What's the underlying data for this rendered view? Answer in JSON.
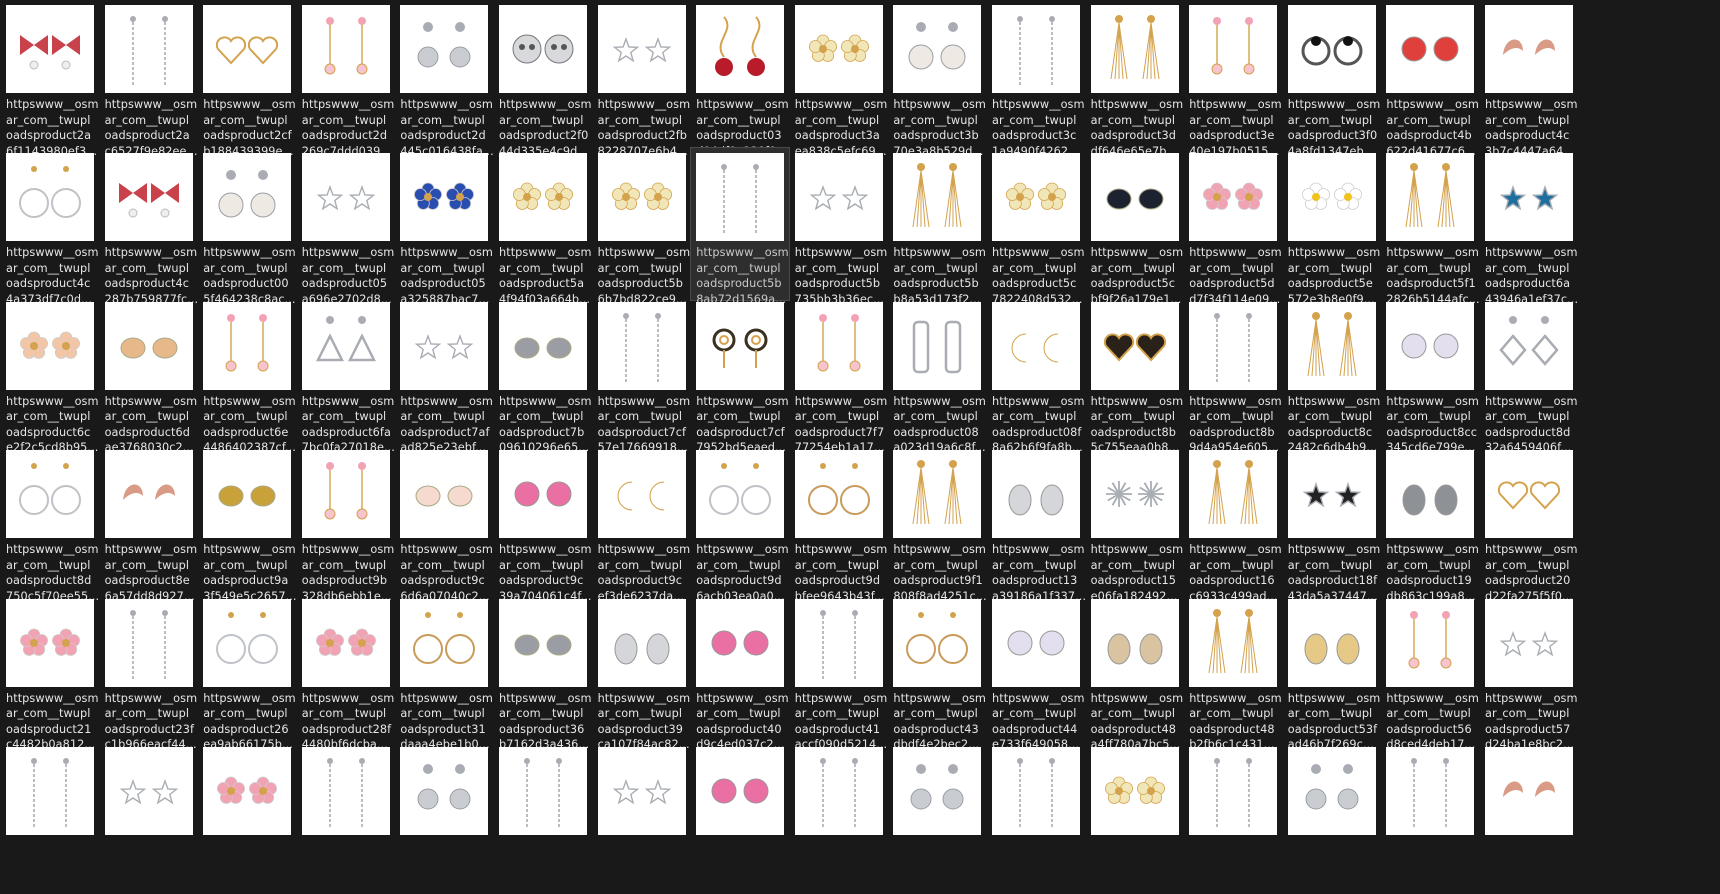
{
  "window": {
    "background": "#191919",
    "selected_tile": [
      1,
      7
    ]
  },
  "files": [
    [
      "httpswww__osm|ar_com__twupl|oadsproduct2a|6f1143980ef3...|bow",
      "httpswww__osm|ar_com__twupl|oadsproduct2a|c6527f9e82ee...|chain",
      "httpswww__osm|ar_com__twupl|oadsproduct2cf|b188439399e...|heart",
      "httpswww__osm|ar_com__twupl|oadsproduct2d|269c7ddd039...|flower-drop",
      "httpswww__osm|ar_com__twupl|oadsproduct2d|445c016438fa...|ball",
      "httpswww__osm|ar_com__twupl|oadsproduct2f0|44d335e4c9d...|skull",
      "httpswww__osm|ar_com__twupl|oadsproduct2fb|8228707e6b4...|star-drop",
      "httpswww__osm|ar_com__twupl|oadsproduct03|d94df0a130f0...|rose",
      "httpswww__osm|ar_com__twupl|oadsproduct3a|ea838c5efc69...|flower",
      "httpswww__osm|ar_com__twupl|oadsproduct3b|70e3a8b529d...|pearl",
      "httpswww__osm|ar_com__twupl|oadsproduct3c|1a9490f4262...|chain",
      "httpswww__osm|ar_com__twupl|oadsproduct3d|df646e65e7b...|fringe",
      "httpswww__osm|ar_com__twupl|oadsproduct3e|40e197b0515...|flower-drop",
      "httpswww__osm|ar_com__twupl|oadsproduct3f0|4a8fd1347eb...|ring",
      "httpswww__osm|ar_com__twupl|oadsproduct4b|622d41677c6...|stud-red",
      "httpswww__osm|ar_com__twupl|oadsproduct4c|3b7c4447a64...|dolphin"
    ],
    [
      "httpswww__osm|ar_com__twupl|oadsproduct4c|4a373df7c0d...|hoop",
      "httpswww__osm|ar_com__twupl|oadsproduct4c|287b759877fc...|bow",
      "httpswww__osm|ar_com__twupl|oadsproduct00|5f464238c8ac...|pearl",
      "httpswww__osm|ar_com__twupl|oadsproduct05|a696e2702d8...|star",
      "httpswww__osm|ar_com__twupl|oadsproduct05|a325887bac7...|flower-blue",
      "httpswww__osm|ar_com__twupl|oadsproduct5a|4f94f03a664b...|flower",
      "httpswww__osm|ar_com__twupl|oadsproduct5b|6b7bd822ce9...|flower",
      "httpswww__osm|ar_com__twupl|oadsproduct5b|8ab72d1569a...|chain",
      "httpswww__osm|ar_com__twupl|oadsproduct5b|735bb3b36ec...|star",
      "httpswww__osm|ar_com__twupl|oadsproduct5b|b8a53d173f2...|fringe",
      "httpswww__osm|ar_com__twupl|oadsproduct5c|7822408d532...|flower",
      "httpswww__osm|ar_com__twupl|oadsproduct5c|bf9f26a179e1...|dog",
      "httpswww__osm|ar_com__twupl|oadsproduct5d|d7f34f114e09...|flower-pink",
      "httpswww__osm|ar_com__twupl|oadsproduct5e|572e3b8e0f9...|daisy",
      "httpswww__osm|ar_com__twupl|oadsproduct5f1|2826b5144afc...|fringe",
      "httpswww__osm|ar_com__twupl|oadsproduct6a|43946a1ef37c...|star-blue"
    ],
    [
      "httpswww__osm|ar_com__twupl|oadsproduct6c|e2f2c5cd8b95...|rose-stud",
      "httpswww__osm|ar_com__twupl|oadsproduct6d|ae3768030c2...|guitar",
      "httpswww__osm|ar_com__twupl|oadsproduct6e|4486402387cf...|flower-drop",
      "httpswww__osm|ar_com__twupl|oadsproduct6fa|7bc0fa27018e...|triangle",
      "httpswww__osm|ar_com__twupl|oadsproduct7af|ad825e23ebf...|star",
      "httpswww__osm|ar_com__twupl|oadsproduct7b|09610296e65...|fish",
      "httpswww__osm|ar_com__twupl|oadsproduct7cf|57e17669918...|chain",
      "httpswww__osm|ar_com__twupl|oadsproduct7cf|7952bd5eaed...|spiral",
      "httpswww__osm|ar_com__twupl|oadsproduct7f7|77254eb1a17...|flower-drop",
      "httpswww__osm|ar_com__twupl|oadsproduct08|a023d19a6c8f...|rect",
      "httpswww__osm|ar_com__twupl|oadsproduct08f|8a62b6f9fa8b...|moon",
      "httpswww__osm|ar_com__twupl|oadsproduct8b|5c755eaa0b8...|heart-dark",
      "httpswww__osm|ar_com__twupl|oadsproduct8b|9d4a954e605...|chain",
      "httpswww__osm|ar_com__twupl|oadsproduct8c|2482c6db4b9...|fringe",
      "httpswww__osm|ar_com__twupl|oadsproduct8cc|345cd6e799e...|stud-white",
      "httpswww__osm|ar_com__twupl|oadsproduct8d|32a6459406f...|diamond"
    ],
    [
      "httpswww__osm|ar_com__twupl|oadsproduct8d|750c5f70ee55...|hoop",
      "httpswww__osm|ar_com__twupl|oadsproduct8e|6a57dd8d927...|dolphin",
      "httpswww__osm|ar_com__twupl|oadsproduct9a|3f549e5c2657...|cat",
      "httpswww__osm|ar_com__twupl|oadsproduct9b|328db6ebb1e...|flower-drop",
      "httpswww__osm|ar_com__twupl|oadsproduct9c|6d6a07040c2...|clover",
      "httpswww__osm|ar_com__twupl|oadsproduct9c|39a704061c4f...|stud-pink",
      "httpswww__osm|ar_com__twupl|oadsproduct9c|ef3de6237da...|moon",
      "httpswww__osm|ar_com__twupl|oadsproduct9d|6acb03ea0a0...|hoop",
      "httpswww__osm|ar_com__twupl|oadsproduct9d|bfee9643b43f...|wreath",
      "httpswww__osm|ar_com__twupl|oadsproduct9f1|808f8ad4251c...|fringe",
      "httpswww__osm|ar_com__twupl|oadsproduct13|a39186a1f337...|cuff",
      "httpswww__osm|ar_com__twupl|oadsproduct15|e06fa182492...|snowflake",
      "httpswww__osm|ar_com__twupl|oadsproduct16|c6933c499ad...|fringe",
      "httpswww__osm|ar_com__twupl|oadsproduct18f|43da5a37447...|star-dark",
      "httpswww__osm|ar_com__twupl|oadsproduct19|db863c199a8...|drop",
      "httpswww__osm|ar_com__twupl|oadsproduct20|d22fa275f5f0...|heart"
    ],
    [
      "httpswww__osm|ar_com__twupl|oadsproduct21|c4482b0a812...|flower-pink",
      "httpswww__osm|ar_com__twupl|oadsproduct23f|c1b966eacf44...|chain",
      "httpswww__osm|ar_com__twupl|oadsproduct26|ea9ab66175b...|hoop",
      "httpswww__osm|ar_com__twupl|oadsproduct28f|4480bf6dcba...|flower-pink",
      "httpswww__osm|ar_com__twupl|oadsproduct31|daaa4ebe1b0...|wreath",
      "httpswww__osm|ar_com__twupl|oadsproduct36|b7162d3a436...|fish",
      "httpswww__osm|ar_com__twupl|oadsproduct39|ca107f84ac82...|cuff",
      "httpswww__osm|ar_com__twupl|oadsproduct40|d9c4ed037c2...|stud-pink",
      "httpswww__osm|ar_com__twupl|oadsproduct41|accf090d5214...|chain",
      "httpswww__osm|ar_com__twupl|oadsproduct43|dbdf4e2bec2...|wreath",
      "httpswww__osm|ar_com__twupl|oadsproduct44|e733f649058...|stud-white",
      "httpswww__osm|ar_com__twupl|oadsproduct48|a4ff780a7bc5...|stone",
      "httpswww__osm|ar_com__twupl|oadsproduct48|b2fb6c1c431...|fringe",
      "httpswww__osm|ar_com__twupl|oadsproduct53f|ad46b7f269c...|disc",
      "httpswww__osm|ar_com__twupl|oadsproduct56|d8ced4deb17...|flower-drop",
      "httpswww__osm|ar_com__twupl|oadsproduct57|d24ba1e8bc2...|star"
    ],
    [
      "||||chain",
      "||||star",
      "||||flower-pink",
      "||||chain",
      "||||ball",
      "||||chain",
      "||||star",
      "||||stud-pink",
      "||||chain",
      "||||ball",
      "||||chain",
      "||||flower",
      "||||chain",
      "||||ball",
      "||||chain",
      "||||dolphin"
    ]
  ]
}
